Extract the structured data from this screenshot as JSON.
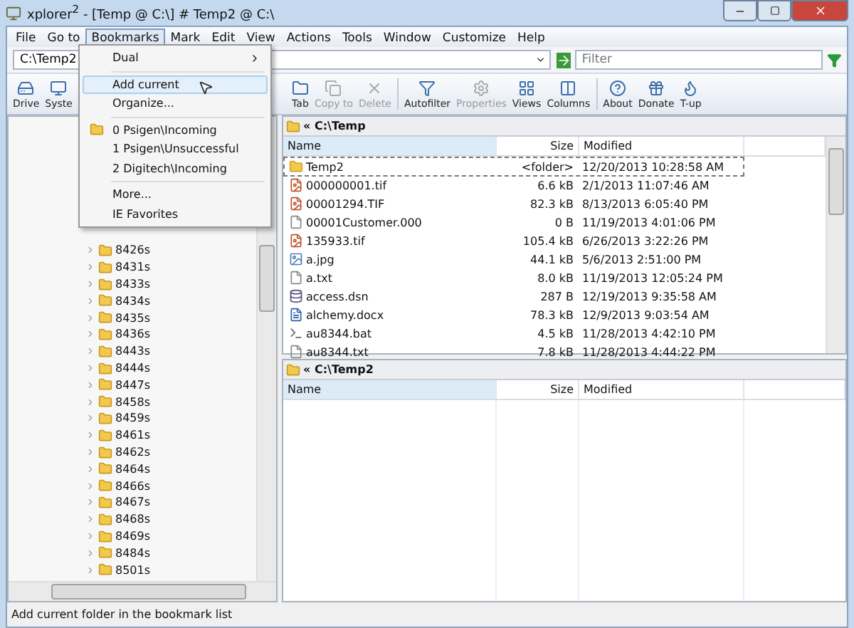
{
  "window": {
    "title": "xplorer$^{2}$ - [Temp @ C:\\] # Temp2 @ C:\\"
  },
  "menu_bar": [
    {
      "label": "File",
      "selected": false
    },
    {
      "label": "Go to",
      "selected": false
    },
    {
      "label": "Bookmarks",
      "selected": true
    },
    {
      "label": "Mark",
      "selected": false
    },
    {
      "label": "Edit",
      "selected": false
    },
    {
      "label": "View",
      "selected": false
    },
    {
      "label": "Actions",
      "selected": false
    },
    {
      "label": "Tools",
      "selected": false
    },
    {
      "label": "Window",
      "selected": false
    },
    {
      "label": "Customize",
      "selected": false
    },
    {
      "label": "Help",
      "selected": false
    }
  ],
  "bookmarks_menu": {
    "sections": [
      [
        {
          "label": "Dual",
          "kind": "submenu",
          "selected": false
        }
      ],
      [
        {
          "label": "Add current",
          "kind": "item",
          "selected": true
        },
        {
          "label": "Organize...",
          "kind": "item",
          "selected": false
        }
      ],
      [
        {
          "label": "0 Psigen\\Incoming",
          "kind": "folder",
          "selected": false
        },
        {
          "label": "1 Psigen\\Unsuccessful",
          "kind": "item",
          "selected": false
        },
        {
          "label": "2 Digitech\\Incoming",
          "kind": "item",
          "selected": false
        }
      ],
      [
        {
          "label": "More...",
          "kind": "item",
          "selected": false
        },
        {
          "label": "IE Favorites",
          "kind": "item",
          "selected": false
        }
      ]
    ]
  },
  "address": {
    "value": "C:\\Temp2"
  },
  "filter": {
    "placeholder": "Filter"
  },
  "toolbar": [
    {
      "label": "Drive",
      "kind": "drive",
      "disabled": false
    },
    {
      "label": "Syste",
      "kind": "system",
      "disabled": false
    },
    {
      "label": "Tab",
      "kind": "tab",
      "disabled": false
    },
    {
      "label": "Copy to",
      "kind": "copy",
      "disabled": true
    },
    {
      "label": "Delete",
      "kind": "delete",
      "disabled": true
    },
    {
      "label": "Autofilter",
      "kind": "autofilter",
      "disabled": false
    },
    {
      "label": "Properties",
      "kind": "properties",
      "disabled": true
    },
    {
      "label": "Views",
      "kind": "views",
      "disabled": false
    },
    {
      "label": "Columns",
      "kind": "columns",
      "disabled": false
    },
    {
      "label": "About",
      "kind": "about",
      "disabled": false
    },
    {
      "label": "Donate",
      "kind": "donate",
      "disabled": false
    },
    {
      "label": "T-up",
      "kind": "tup",
      "disabled": false
    }
  ],
  "tree": {
    "items": [
      "8426s",
      "8431s",
      "8433s",
      "8434s",
      "8435s",
      "8436s",
      "8443s",
      "8444s",
      "8447s",
      "8458s",
      "8459s",
      "8461s",
      "8462s",
      "8464s",
      "8466s",
      "8467s",
      "8468s",
      "8469s",
      "8484s",
      "8501s"
    ]
  },
  "panes": [
    {
      "path": "« C:\\Temp",
      "columns": [
        "Name",
        "Size",
        "Modified"
      ],
      "rows": [
        {
          "name": "Temp2",
          "size": "<folder>",
          "modified": "12/20/2013 10:28:58 AM",
          "kind": "folder",
          "selected": true
        },
        {
          "name": "000000001.tif",
          "size": "6.6 kB",
          "modified": "2/1/2013 11:07:46 AM",
          "kind": "image",
          "selected": false
        },
        {
          "name": "00001294.TIF",
          "size": "82.3 kB",
          "modified": "8/13/2013 6:05:40 PM",
          "kind": "image",
          "selected": false
        },
        {
          "name": "00001Customer.000",
          "size": "0 B",
          "modified": "11/19/2013 4:01:06 PM",
          "kind": "file",
          "selected": false
        },
        {
          "name": "135933.tif",
          "size": "105.4 kB",
          "modified": "6/26/2013 3:22:26 PM",
          "kind": "image",
          "selected": false
        },
        {
          "name": "a.jpg",
          "size": "44.1 kB",
          "modified": "5/6/2013 2:51:00 PM",
          "kind": "photo",
          "selected": false
        },
        {
          "name": "a.txt",
          "size": "8.0 kB",
          "modified": "11/19/2013 12:05:24 PM",
          "kind": "file",
          "selected": false
        },
        {
          "name": "access.dsn",
          "size": "287 B",
          "modified": "12/19/2013 9:35:58 AM",
          "kind": "data",
          "selected": false
        },
        {
          "name": "alchemy.docx",
          "size": "78.3 kB",
          "modified": "12/9/2013 9:03:54 AM",
          "kind": "doc",
          "selected": false
        },
        {
          "name": "au8344.bat",
          "size": "4.5 kB",
          "modified": "11/28/2013 4:42:10 PM",
          "kind": "script",
          "selected": false
        },
        {
          "name": "au8344.txt",
          "size": "7.8 kB",
          "modified": "11/28/2013 4:44:22 PM",
          "kind": "file",
          "selected": false
        }
      ]
    },
    {
      "path": "« C:\\Temp2",
      "columns": [
        "Name",
        "Size",
        "Modified"
      ]
    }
  ],
  "status_bar": "Add current folder in the bookmark list"
}
